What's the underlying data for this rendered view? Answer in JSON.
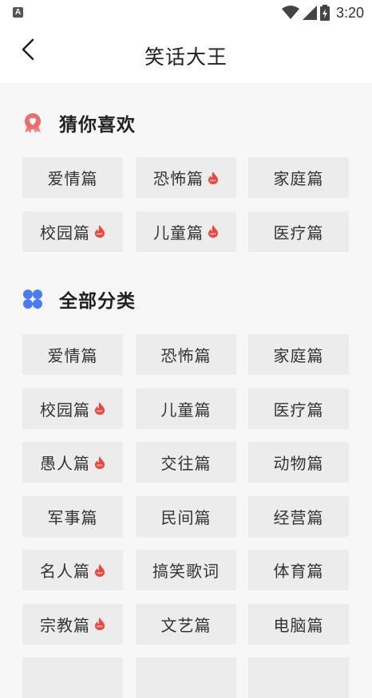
{
  "status_bar": {
    "time": "3:20",
    "app_icon": "A"
  },
  "header": {
    "title": "笑话大王"
  },
  "sections": [
    {
      "title": "猜你喜欢",
      "icon": "ribbon-heart-icon",
      "items": [
        {
          "label": "爱情篇",
          "hot": false
        },
        {
          "label": "恐怖篇",
          "hot": true
        },
        {
          "label": "家庭篇",
          "hot": false
        },
        {
          "label": "校园篇",
          "hot": true
        },
        {
          "label": "儿童篇",
          "hot": true
        },
        {
          "label": "医疗篇",
          "hot": false
        }
      ]
    },
    {
      "title": "全部分类",
      "icon": "four-petal-icon",
      "items": [
        {
          "label": "爱情篇",
          "hot": false
        },
        {
          "label": "恐怖篇",
          "hot": false
        },
        {
          "label": "家庭篇",
          "hot": false
        },
        {
          "label": "校园篇",
          "hot": true
        },
        {
          "label": "儿童篇",
          "hot": false
        },
        {
          "label": "医疗篇",
          "hot": false
        },
        {
          "label": "愚人篇",
          "hot": true
        },
        {
          "label": "交往篇",
          "hot": false
        },
        {
          "label": "动物篇",
          "hot": false
        },
        {
          "label": "军事篇",
          "hot": false
        },
        {
          "label": "民间篇",
          "hot": false
        },
        {
          "label": "经营篇",
          "hot": false
        },
        {
          "label": "名人篇",
          "hot": true
        },
        {
          "label": "搞笑歌词",
          "hot": false
        },
        {
          "label": "体育篇",
          "hot": false
        },
        {
          "label": "宗教篇",
          "hot": true
        },
        {
          "label": "文艺篇",
          "hot": false
        },
        {
          "label": "电脑篇",
          "hot": false
        },
        {
          "label": "",
          "hot": false
        },
        {
          "label": "",
          "hot": false
        },
        {
          "label": "",
          "hot": false
        }
      ]
    }
  ],
  "colors": {
    "accent_red": "#f0433a",
    "accent_blue": "#4a7cf0",
    "chip_bg": "#ececec"
  }
}
